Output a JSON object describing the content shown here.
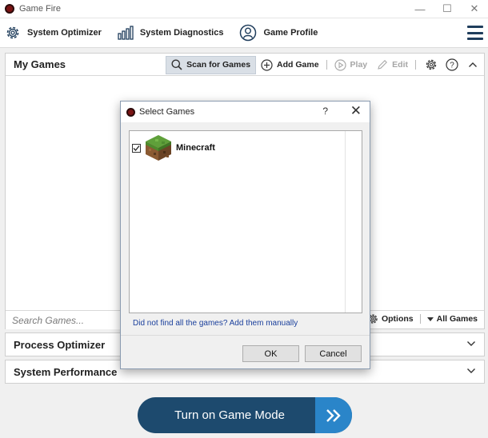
{
  "window": {
    "title": "Game Fire",
    "minimize": "—",
    "maximize": "☐",
    "close": "✕"
  },
  "toolbar": {
    "items": [
      {
        "label": "System Optimizer",
        "icon": "gear-icon"
      },
      {
        "label": "System Diagnostics",
        "icon": "bar-chart-icon"
      },
      {
        "label": "Game Profile",
        "icon": "profile-icon"
      }
    ],
    "menu_icon": "hamburger-menu-icon"
  },
  "my_games": {
    "title": "My Games",
    "scan_label": "Scan for Games",
    "add_label": "Add Game",
    "play_label": "Play",
    "edit_label": "Edit",
    "search_placeholder": "Search Games...",
    "options_label": "Options",
    "filter_label": "All Games"
  },
  "sections": [
    {
      "title": "Process Optimizer"
    },
    {
      "title": "System Performance"
    }
  ],
  "game_mode_button": {
    "label": "Turn on Game Mode"
  },
  "dialog": {
    "title": "Select Games",
    "help": "?",
    "close": "✕",
    "games": [
      {
        "name": "Minecraft",
        "checked": true
      }
    ],
    "manual_link": "Did not find all the games? Add them manually",
    "ok_label": "OK",
    "cancel_label": "Cancel"
  },
  "colors": {
    "accent_dark": "#1d4a6e",
    "accent_light": "#2a85c9",
    "link": "#1a3f9c",
    "icon_blue": "#1f3d5c"
  }
}
